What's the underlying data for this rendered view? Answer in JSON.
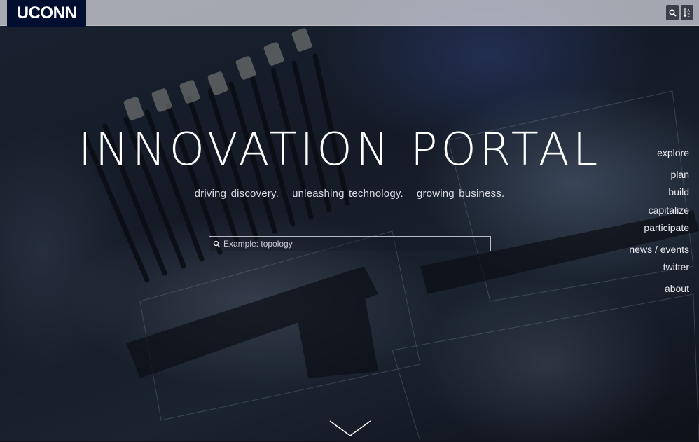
{
  "header": {
    "logo_text": "UCONN",
    "search_button_icon": "search-icon",
    "sort_button_icon": "sort-az-icon"
  },
  "hero": {
    "title": "INNOVATION PORTAL",
    "tagline": "driving discovery.   unleashing technology.   growing business.",
    "search": {
      "placeholder": "Example: topology",
      "value": ""
    },
    "scroll_icon": "chevron-down-icon"
  },
  "nav": {
    "items": [
      {
        "label": "explore"
      },
      {
        "label": "plan"
      },
      {
        "label": "build"
      },
      {
        "label": "capitalize"
      },
      {
        "label": "participate"
      },
      {
        "label": "news / events"
      },
      {
        "label": "twitter"
      },
      {
        "label": "about"
      }
    ]
  },
  "colors": {
    "logo_bg": "#000e2f",
    "text": "#ffffff"
  }
}
